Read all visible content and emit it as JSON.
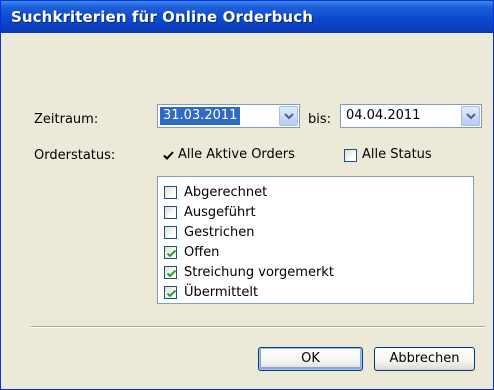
{
  "window": {
    "title": "Suchkriterien für Online Orderbuch"
  },
  "period": {
    "label": "Zeitraum:",
    "from_value": "31.03.2011",
    "to_label": "bis:",
    "to_value": "04.04.2011"
  },
  "orderstatus": {
    "label": "Orderstatus:",
    "all_active": {
      "label": "Alle Aktive Orders",
      "checked": true
    },
    "all_status": {
      "label": "Alle Status",
      "checked": false
    },
    "items": [
      {
        "label": "Abgerechnet",
        "checked": false
      },
      {
        "label": "Ausgeführt",
        "checked": false
      },
      {
        "label": "Gestrichen",
        "checked": false
      },
      {
        "label": "Offen",
        "checked": true
      },
      {
        "label": "Streichung vorgemerkt",
        "checked": true
      },
      {
        "label": "Übermittelt",
        "checked": true
      }
    ]
  },
  "buttons": {
    "ok": "OK",
    "cancel": "Abbrechen"
  },
  "colors": {
    "titlebar": "#0a4ad0",
    "dialog_bg": "#ece9d8",
    "selection": "#316ac5",
    "check_green": "#21a121"
  }
}
